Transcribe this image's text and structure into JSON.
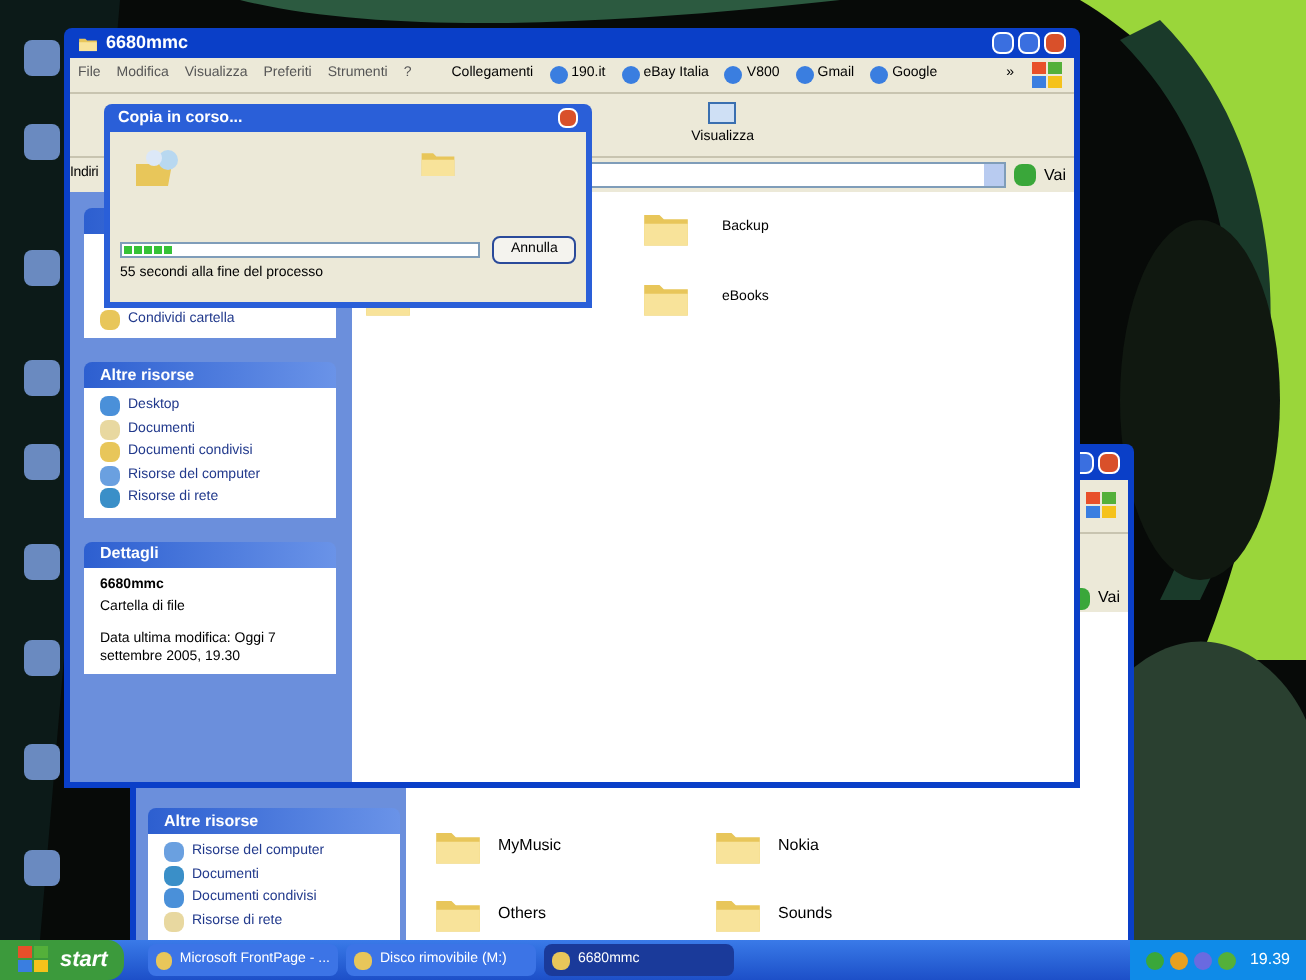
{
  "explorer_back": {
    "go_button": "Vai",
    "panel": {
      "title": "Altre risorse",
      "items": [
        "Risorse del computer",
        "Documenti",
        "Documenti condivisi",
        "Risorse di rete"
      ]
    },
    "folders": [
      {
        "name": "MyMusic"
      },
      {
        "name": "Nokia"
      },
      {
        "name": "Others"
      },
      {
        "name": "Sounds"
      }
    ]
  },
  "explorer": {
    "title": "6680mmc",
    "menu": [
      "File",
      "Modifica",
      "Visualizza",
      "Preferiti",
      "Strumenti",
      "?"
    ],
    "links_label": "Collegamenti",
    "links": [
      "190.it",
      "eBay Italia",
      "V800",
      "Gmail",
      "Google"
    ],
    "links_more": "»",
    "toolbar": [
      "Visualizza"
    ],
    "address_label": "Indiri",
    "go_button": "Vai",
    "task_item": "Condividi cartella",
    "other_places": {
      "title": "Altre risorse",
      "items": [
        "Desktop",
        "Documenti",
        "Documenti condivisi",
        "Risorse del computer",
        "Risorse di rete"
      ]
    },
    "details": {
      "title": "Dettagli",
      "name": "6680mmc",
      "type": "Cartella di file",
      "modified": "Data ultima modifica: Oggi 7 settembre 2005, 19.30"
    },
    "folders": [
      {
        "name": "Backup"
      },
      {
        "name": "eBooks"
      }
    ]
  },
  "dialog": {
    "title": "Copia in corso...",
    "progress": {
      "level": 0.14
    },
    "status": "55 secondi alla fine del processo",
    "button": "Annulla"
  },
  "taskbar": {
    "start": "start",
    "tasks": [
      {
        "label": "Microsoft FrontPage - ...",
        "selected": false
      },
      {
        "label": "Disco rimovibile (M:)",
        "selected": false
      },
      {
        "label": "6680mmc",
        "selected": true
      }
    ],
    "clock": "19.39"
  }
}
